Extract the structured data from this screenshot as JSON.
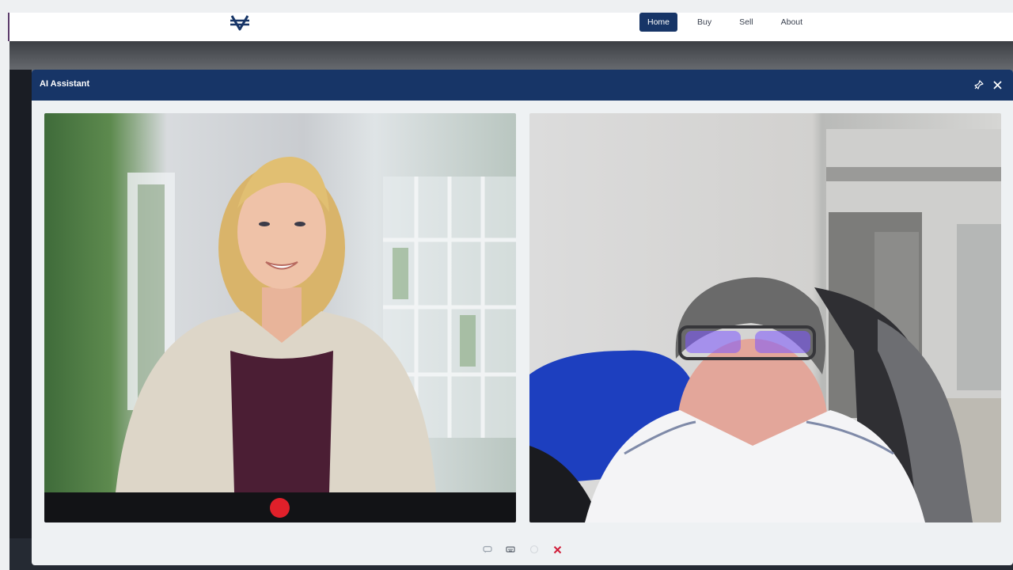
{
  "nav": {
    "logo_icon": "currency-logo-icon",
    "items": [
      {
        "label": "Home",
        "active": true
      },
      {
        "label": "Buy",
        "active": false
      },
      {
        "label": "Sell",
        "active": false
      },
      {
        "label": "About",
        "active": false
      }
    ]
  },
  "modal": {
    "title": "AI Assistant",
    "header_icons": [
      "pin-icon",
      "close-icon"
    ]
  },
  "panels": {
    "ai": {
      "record_button": "record-icon"
    },
    "user": {}
  },
  "toolbar": {
    "icons": [
      "chat-icon",
      "keyboard-icon",
      "circle-icon",
      "end-call-icon"
    ]
  },
  "colors": {
    "accent": "#173567",
    "record": "#e0202a",
    "end_call": "#d11f3a"
  }
}
